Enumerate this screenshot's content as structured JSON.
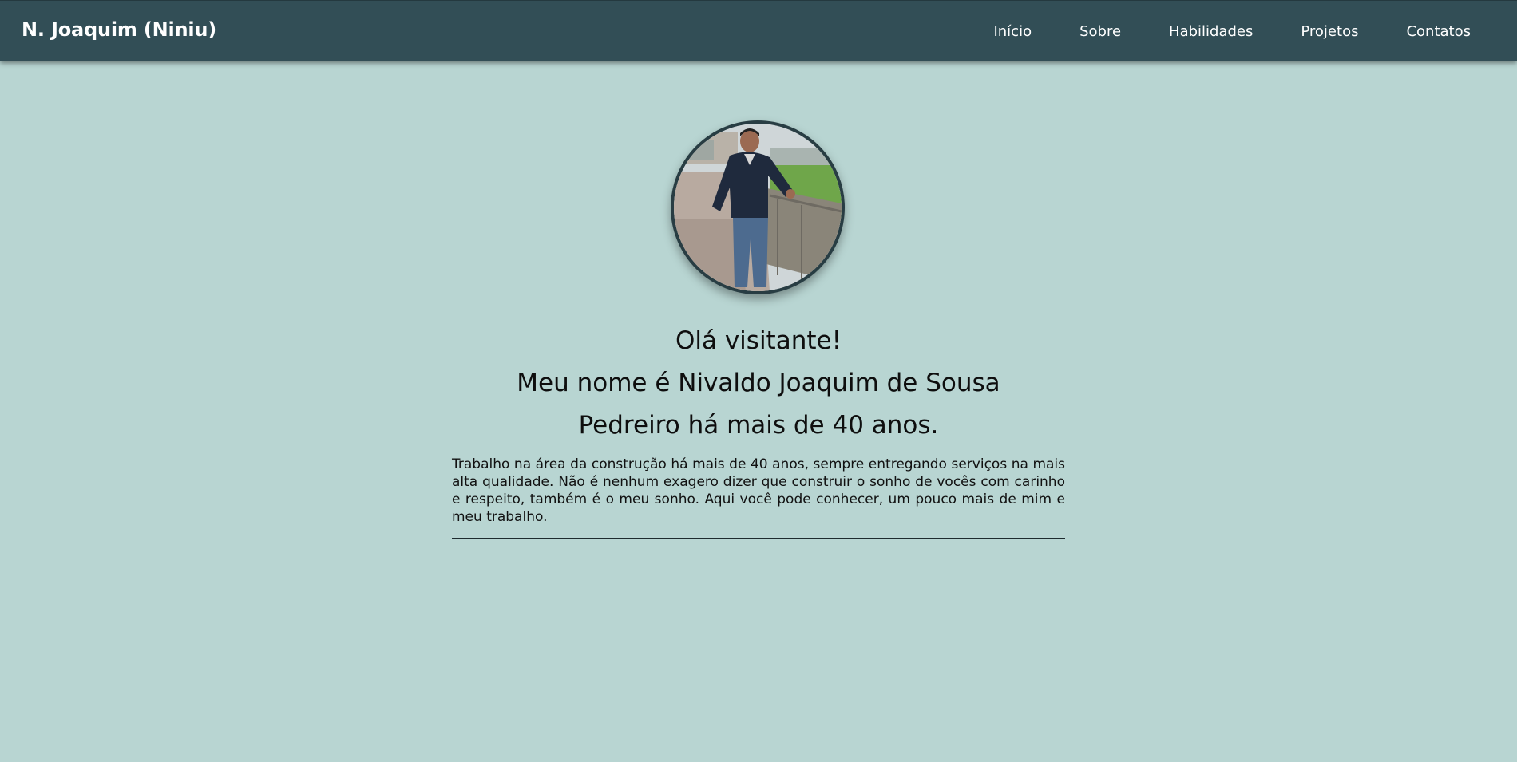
{
  "navbar": {
    "brand": "N. Joaquim (Niniu)",
    "links": [
      "Início",
      "Sobre",
      "Habilidades",
      "Projetos",
      "Contatos"
    ]
  },
  "hero": {
    "greeting": "Olá visitante!",
    "name_line": "Meu nome é Nivaldo Joaquim de Sousa",
    "role_line": "Pedreiro há mais de 40 anos.",
    "about_text": "Trabalho na área da construção há mais de 40 anos, sempre entregando serviços na mais alta qualidade. Não é nenhum exagero dizer que construir o sonho de vocês com carinho e respeito, também é o meu sonho. Aqui você pode conhecer, um pouco mais de mim e meu trabalho."
  },
  "colors": {
    "navbar_bg": "#324e56",
    "page_bg": "#b8d5d2",
    "avatar_border": "#283d43"
  }
}
